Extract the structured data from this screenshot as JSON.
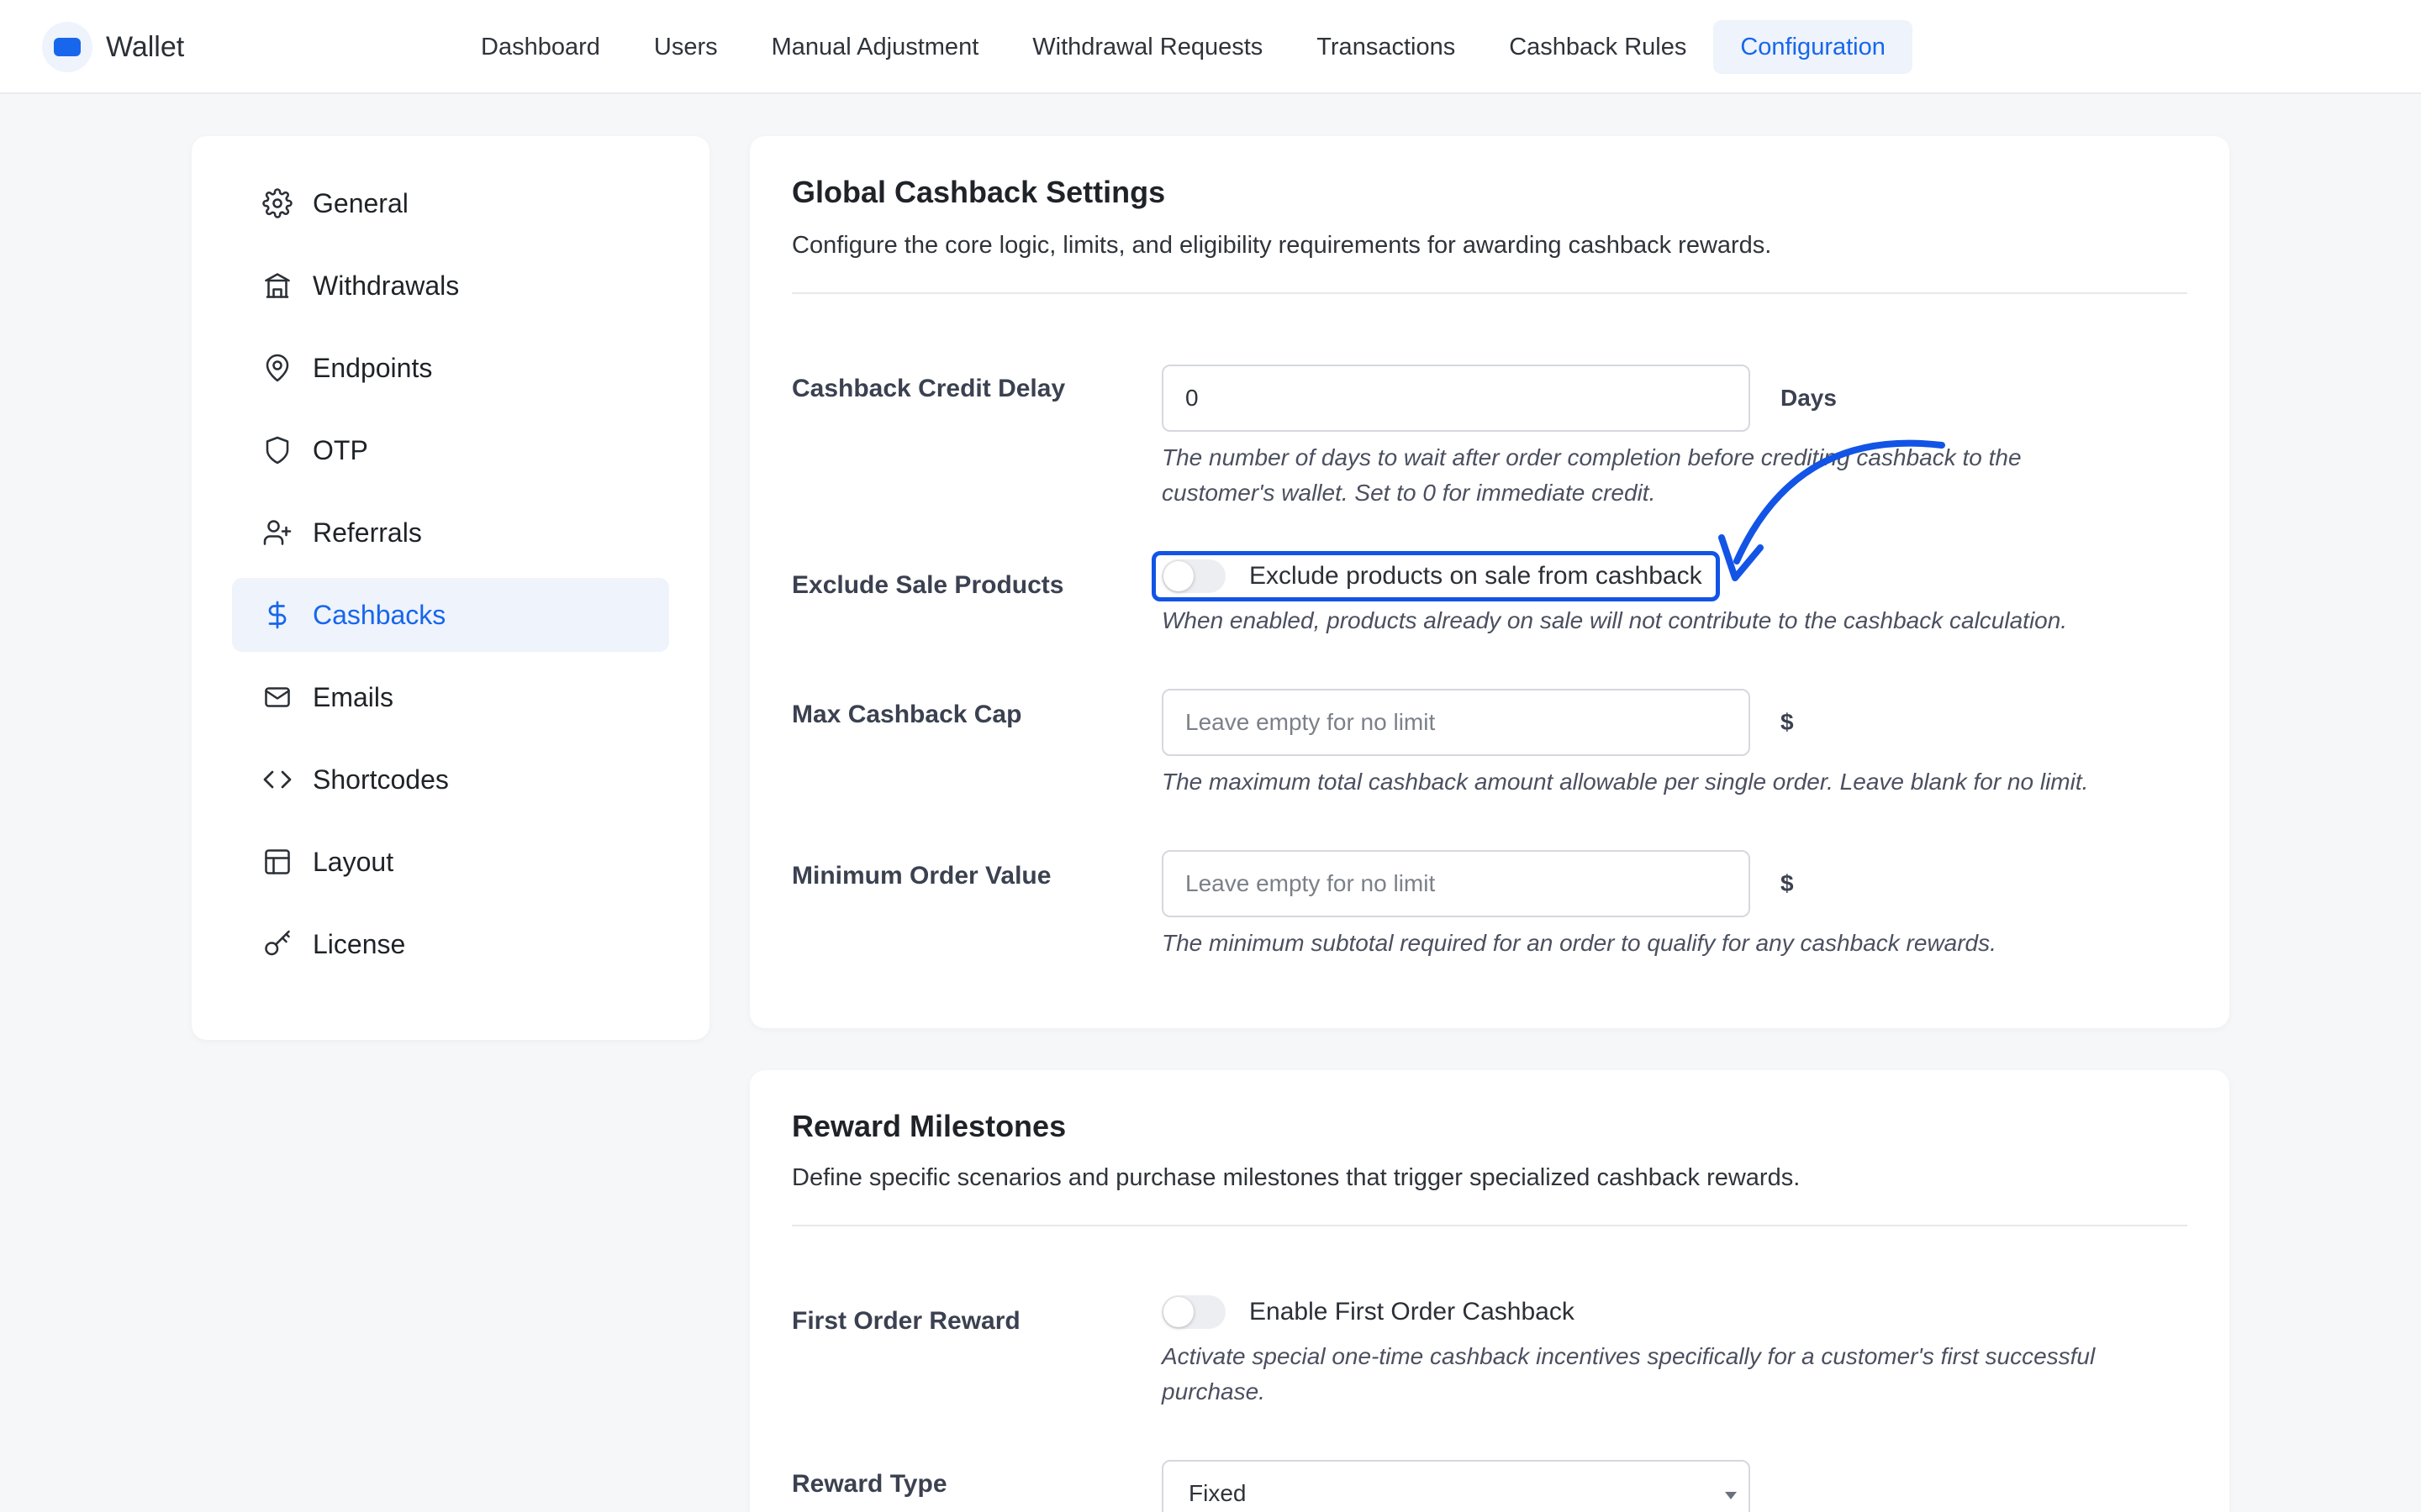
{
  "brand": {
    "name": "Wallet"
  },
  "nav": {
    "items": [
      {
        "label": "Dashboard",
        "active": false
      },
      {
        "label": "Users",
        "active": false
      },
      {
        "label": "Manual Adjustment",
        "active": false
      },
      {
        "label": "Withdrawal Requests",
        "active": false
      },
      {
        "label": "Transactions",
        "active": false
      },
      {
        "label": "Cashback Rules",
        "active": false
      },
      {
        "label": "Configuration",
        "active": true
      }
    ]
  },
  "sidebar": {
    "items": [
      {
        "label": "General",
        "icon": "gear-icon"
      },
      {
        "label": "Withdrawals",
        "icon": "bank-icon"
      },
      {
        "label": "Endpoints",
        "icon": "map-pin-icon"
      },
      {
        "label": "OTP",
        "icon": "shield-icon"
      },
      {
        "label": "Referrals",
        "icon": "user-plus-icon"
      },
      {
        "label": "Cashbacks",
        "icon": "dollar-icon",
        "active": true
      },
      {
        "label": "Emails",
        "icon": "mail-icon"
      },
      {
        "label": "Shortcodes",
        "icon": "code-icon"
      },
      {
        "label": "Layout",
        "icon": "layout-icon"
      },
      {
        "label": "License",
        "icon": "key-icon"
      }
    ]
  },
  "global_settings": {
    "title": "Global Cashback Settings",
    "description": "Configure the core logic, limits, and eligibility requirements for awarding cashback rewards.",
    "credit_delay": {
      "label": "Cashback Credit Delay",
      "value": "0",
      "unit": "Days",
      "help_line1": "The number of days to wait after order completion before crediting cashback to the",
      "help_line2": "customer's wallet. Set to 0 for immediate credit."
    },
    "exclude_sale": {
      "label": "Exclude Sale Products",
      "toggle_label": "Exclude products on sale from cashback",
      "enabled": false,
      "help": "When enabled, products already on sale will not contribute to the cashback calculation."
    },
    "max_cap": {
      "label": "Max Cashback Cap",
      "placeholder": "Leave empty for no limit",
      "unit": "$",
      "help": "The maximum total cashback amount allowable per single order. Leave blank for no limit."
    },
    "min_order": {
      "label": "Minimum Order Value",
      "placeholder": "Leave empty for no limit",
      "unit": "$",
      "help": "The minimum subtotal required for an order to qualify for any cashback rewards."
    }
  },
  "milestones": {
    "title": "Reward Milestones",
    "description": "Define specific scenarios and purchase milestones that trigger specialized cashback rewards.",
    "first_order": {
      "label": "First Order Reward",
      "toggle_label": "Enable First Order Cashback",
      "enabled": false,
      "help_line1": "Activate special one-time cashback incentives specifically for a customer's first successful",
      "help_line2": "purchase."
    },
    "reward_type": {
      "label": "Reward Type",
      "selected": "Fixed"
    }
  },
  "colors": {
    "accent": "#1766ec",
    "annotation": "#1254e6"
  }
}
